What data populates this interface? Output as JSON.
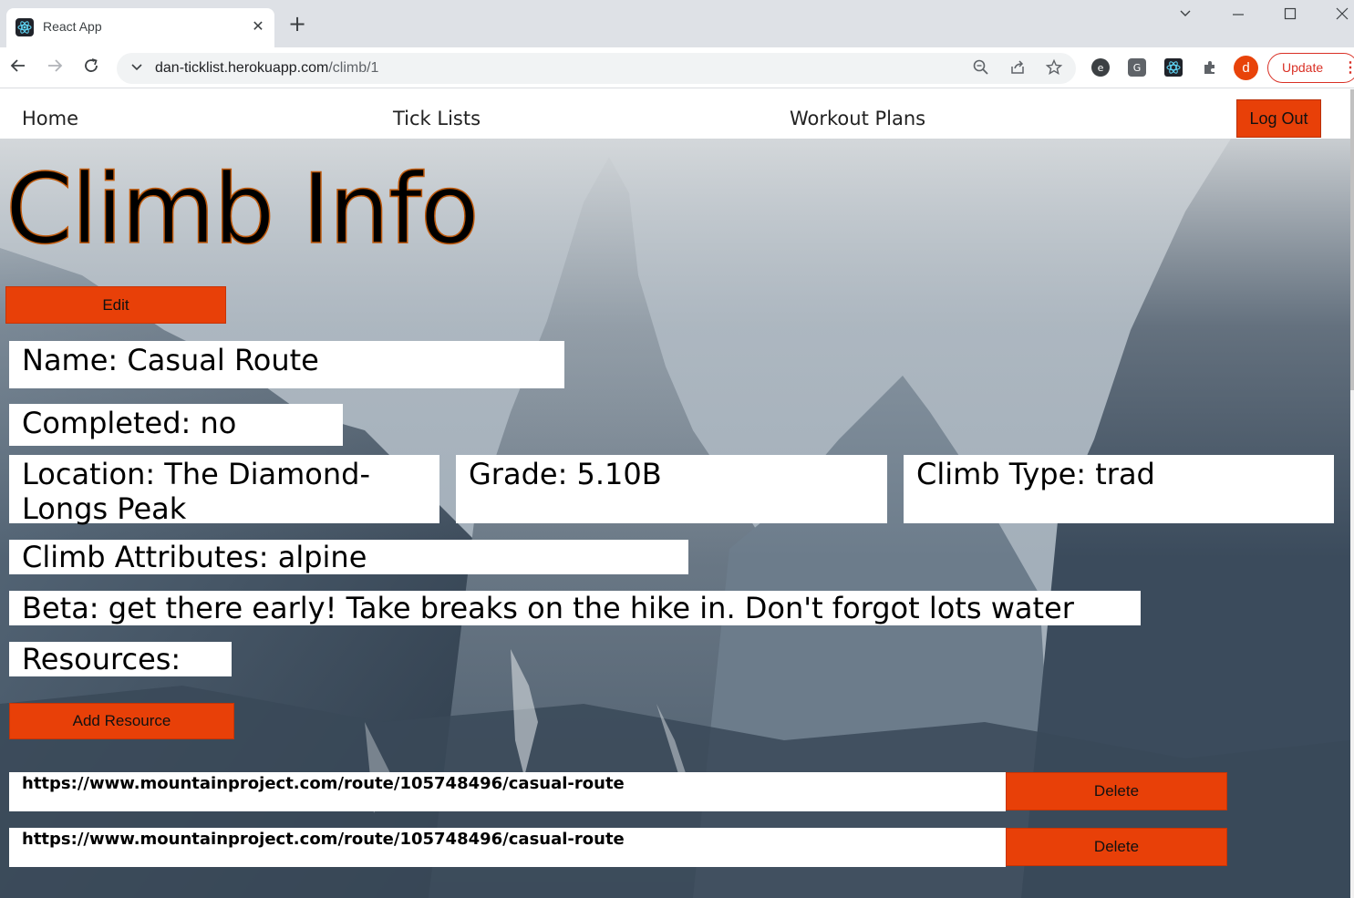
{
  "browser": {
    "tab_title": "React App",
    "tab_close": "✕",
    "new_tab": "+",
    "url_host": "dan-ticklist.herokuapp.com",
    "url_path": "/climb/1",
    "profile_initial": "d",
    "update_label": "Update"
  },
  "nav": {
    "home": "Home",
    "tick_lists": "Tick Lists",
    "workout_plans": "Workout Plans",
    "logout": "Log Out"
  },
  "climb": {
    "heading": "Climb Info",
    "edit_label": "Edit",
    "name": "Name: Casual Route",
    "completed": "Completed: no",
    "location": "Location: The Diamond- Longs Peak",
    "grade": "Grade: 5.10B",
    "climb_type": "Climb Type: trad",
    "attributes": "Climb Attributes: alpine",
    "beta": "Beta: get there early! Take breaks on the hike in. Don't forgot lots water",
    "resources_label": "Resources:",
    "add_resource_label": "Add Resource",
    "resources": [
      {
        "url": "https://www.mountainproject.com/route/105748496/casual-route",
        "delete_label": "Delete"
      },
      {
        "url": "https://www.mountainproject.com/route/105748496/casual-route",
        "delete_label": "Delete"
      }
    ]
  },
  "colors": {
    "accent": "#e84008",
    "field_bg": "#ffffff"
  }
}
